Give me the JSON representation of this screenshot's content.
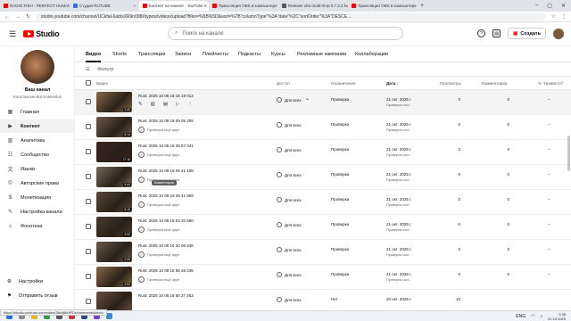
{
  "browser": {
    "tabs": [
      {
        "label": "RADIO FISH - PERFECT HUMAN (rou",
        "icon": "youtube-icon",
        "active": false
      },
      {
        "label": "Студия RUTUBE",
        "icon": "rutube-icon",
        "active": false
      },
      {
        "label": "Контент на канале - YouTube S",
        "icon": "youtube-icon",
        "active": true
      },
      {
        "label": "Трансляция OBS в компьютере нет",
        "icon": "youtube-icon",
        "active": false
      },
      {
        "label": "Release obs-multi-rtmp 0.7.3.2 for",
        "icon": "github-icon",
        "active": false
      },
      {
        "label": "Трансляция OBS в компьютере нет",
        "icon": "youtube-icon",
        "active": false
      }
    ],
    "url": "studio.youtube.com/channel/UCkfat-6ablsXR9n098Xtypow/videos/upload?filter=%5B%5D&sort=%7B\"columnType\"%3A\"date\"%2C\"sortOrder\"%3A\"DESCE..."
  },
  "header": {
    "logo": "Studio",
    "search_placeholder": "Поиск на канале",
    "create_label": "Создать"
  },
  "sidebar": {
    "channel_title": "Ваш канал",
    "channel_sub": "Константин Bot Kolesnilus",
    "items": [
      {
        "label": "Главная",
        "icon": "dashboard-icon"
      },
      {
        "label": "Контент",
        "icon": "content-icon"
      },
      {
        "label": "Аналитика",
        "icon": "analytics-icon"
      },
      {
        "label": "Сообщество",
        "icon": "community-icon"
      },
      {
        "label": "Языки",
        "icon": "subtitles-icon"
      },
      {
        "label": "Авторские права",
        "icon": "copyright-icon"
      },
      {
        "label": "Монетизация",
        "icon": "monetization-icon"
      },
      {
        "label": "Настройка канала",
        "icon": "customization-icon"
      },
      {
        "label": "Фонотека",
        "icon": "audio-library-icon"
      }
    ],
    "settings": "Настройки",
    "feedback": "Отправить отзыв"
  },
  "content_tabs": [
    "Видео",
    "Shorts",
    "Трансляции",
    "Записи",
    "Плейлисты",
    "Подкасты",
    "Курсы",
    "Рекламные кампании",
    "Коллаборации"
  ],
  "filter_label": "Фильтр",
  "table": {
    "headers": {
      "video": "Видео",
      "visibility": "Доступ",
      "restrictions": "Ограничения",
      "date": "Дата",
      "views": "Просмотры",
      "comments": "Комментарии",
      "likes": "% \"Нравится\""
    },
    "rows": [
      {
        "title": "Rust: 2025 10 08 19 18 19 012",
        "duration": "2:40",
        "visibility": "Для всех",
        "restriction": "Проверка",
        "date": "21 окт. 2025 г.",
        "date_note": "Проверка сост...",
        "views": "0",
        "comments": "0",
        "likes": "–",
        "status": "Проверка ещё идет",
        "thumb_color": "#8a6a4a"
      },
      {
        "title": "Rust: 2025 10 08 19 09 05 205",
        "duration": "8:14",
        "visibility": "Для всех",
        "restriction": "Проверка",
        "date": "21 окт. 2025 г.",
        "date_note": "Проверка сост...",
        "views": "0",
        "comments": "0",
        "likes": "–",
        "status": "Проверка ещё идет",
        "thumb_color": "#6b5a4a"
      },
      {
        "title": "Rust: 2025 10 08 19 35 57 041",
        "duration": "17:16",
        "visibility": "Для всех",
        "restriction": "Проверка",
        "date": "21 окт. 2025 г.",
        "date_note": "Проверка сост...",
        "views": "2",
        "comments": "0",
        "likes": "–",
        "status": "Проверка ещё идет",
        "thumb_color": "#3a2520"
      },
      {
        "title": "Rust: 2025 10 08 19 06 21 198",
        "duration": "3:44",
        "visibility": "Для всех",
        "restriction": "Проверка",
        "date": "21 окт. 2025 г.",
        "date_note": "Проверка сост...",
        "views": "0",
        "comments": "0",
        "likes": "–",
        "status": "Проверка ещё идет",
        "thumb_color": "#7a6a5a"
      },
      {
        "title": "Rust: 2025 10 08 19 29 41 869",
        "duration": "6:15",
        "visibility": "Для всех",
        "restriction": "Проверка",
        "date": "21 окт. 2025 г.",
        "date_note": "Проверка сост...",
        "views": "0",
        "comments": "0",
        "likes": "–",
        "status": "Проверка ещё идет",
        "thumb_color": "#5a4a3a"
      },
      {
        "title": "Rust: 2025 10 08 19 03 20 680",
        "duration": "3:00",
        "visibility": "Для всех",
        "restriction": "Проверка",
        "date": "21 окт. 2025 г.",
        "date_note": "Проверка сост...",
        "views": "0",
        "comments": "0",
        "likes": "–",
        "status": "Проверка ещё идет",
        "thumb_color": "#4a3a2a"
      },
      {
        "title": "Rust: 2025 10 08 19 34 06 946",
        "duration": "2:06",
        "visibility": "Для всех",
        "restriction": "Проверка",
        "date": "21 окт. 2025 г.",
        "date_note": "Проверка сост...",
        "views": "0",
        "comments": "0",
        "likes": "–",
        "status": "Проверка ещё идет",
        "thumb_color": "#6a5a4a"
      },
      {
        "title": "Rust: 2025 10 08 18 58 26 236",
        "duration": "4:54",
        "visibility": "Для всех",
        "restriction": "Проверка",
        "date": "21 окт. 2025 г.",
        "date_note": "Проверка сост...",
        "views": "0",
        "comments": "0",
        "likes": "–",
        "status": "Проверка ещё идет",
        "thumb_color": "#8a6a4a"
      },
      {
        "title": "Rust: 2025 10 08 18 50 27 253",
        "duration": "",
        "visibility": "Для всех",
        "restriction": "Нет",
        "date": "20 окт. 2025 г.",
        "date_note": "",
        "views": "10",
        "comments": "",
        "likes": "",
        "status": "",
        "thumb_color": "#6a5040"
      }
    ]
  },
  "tooltip": "Комментарии",
  "status_url": "https://studio.youtube.com/video/3bxlj8kHRCs/comments/inbox",
  "taskbar": {
    "lang": "ENG",
    "time": "9:38",
    "date": "21.10.2025"
  }
}
